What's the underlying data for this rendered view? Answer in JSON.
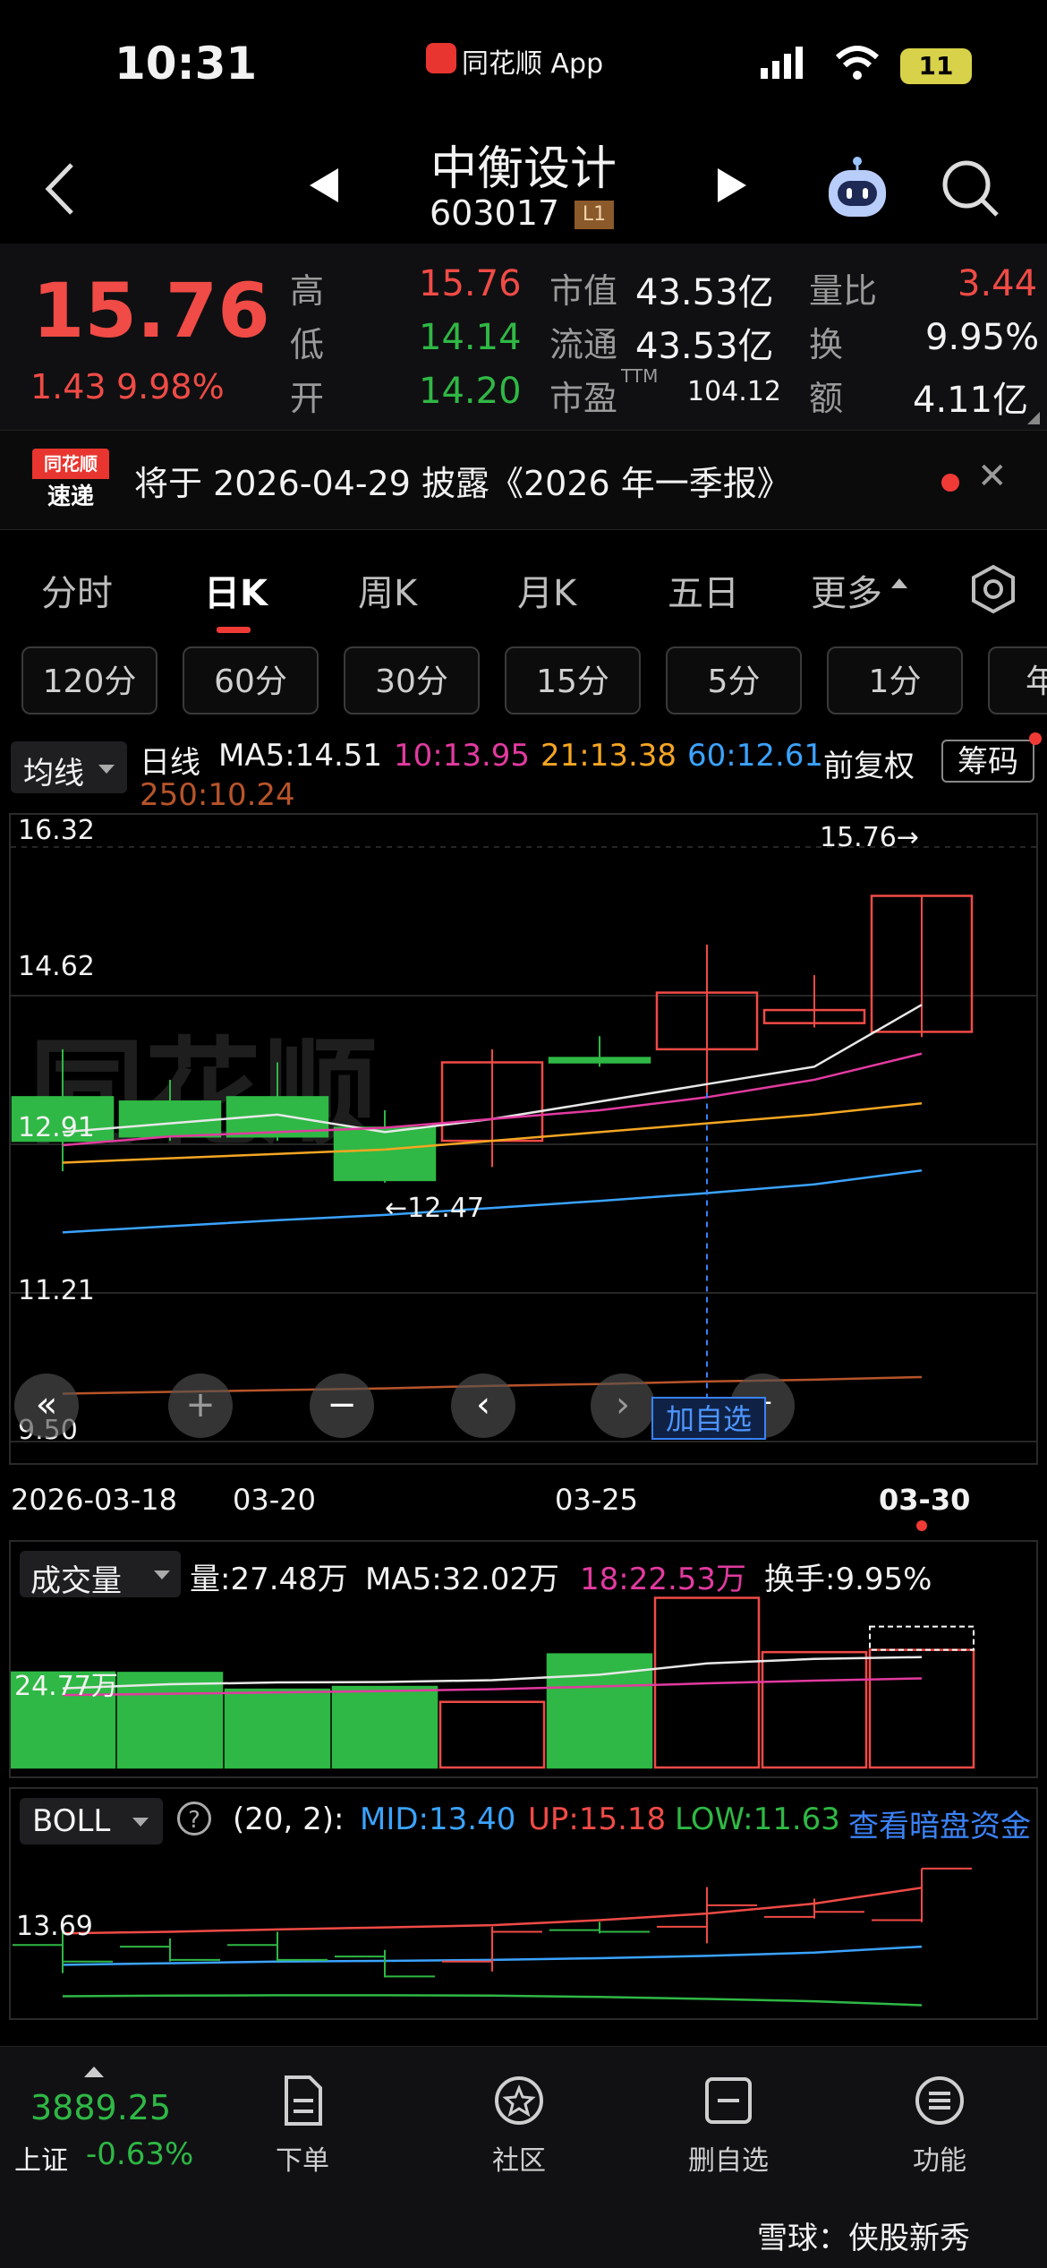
{
  "status_bar": {
    "time": "10:31",
    "app": "同花顺 App",
    "battery": "11"
  },
  "nav": {
    "name": "中衡设计",
    "code": "603017",
    "level_badge": "L1"
  },
  "quote": {
    "price": "15.76",
    "change": "1.43",
    "change_pct": "9.98%",
    "high_label": "高",
    "high": "15.76",
    "low_label": "低",
    "low": "14.14",
    "open_label": "开",
    "open": "14.20",
    "mcap_label": "市值",
    "mcap": "43.53亿",
    "float_label": "流通",
    "float": "43.53亿",
    "pe_label": "市盈",
    "pe_sup": "TTM",
    "pe": "104.12",
    "vr_label": "量比",
    "vr": "3.44",
    "turn_label": "换",
    "turn": "9.95%",
    "amt_label": "额",
    "amt": "4.11亿"
  },
  "notice": {
    "logo_top": "同花顺",
    "logo_bottom": "速递",
    "text": "将于 2026-04-29 披露《2026 年一季报》"
  },
  "tabs": [
    "分时",
    "日K",
    "周K",
    "月K",
    "五日",
    "更多"
  ],
  "active_tab": 1,
  "minute_buttons": [
    "120分",
    "60分",
    "30分",
    "15分",
    "5分",
    "1分",
    "年"
  ],
  "ma": {
    "selector": "均线",
    "kline_label": "日线",
    "ma5": "MA5:14.51",
    "ma10": "10:13.95",
    "ma21": "21:13.38",
    "ma60": "60:12.61",
    "ma250": "250:10.24",
    "fq": "前复权",
    "chip": "筹码"
  },
  "colors": {
    "up": "#f04b46",
    "down": "#2fb845",
    "ma5": "#e8e8e8",
    "ma10": "#e23aa0",
    "ma21": "#f5a623",
    "ma60": "#3ba3ff",
    "ma250": "#b8542a",
    "accent": "#3b82f6"
  },
  "kchart": {
    "y_labels": [
      "16.32",
      "14.62",
      "12.91",
      "11.21",
      "9.50"
    ],
    "high_marker": "15.76→",
    "low_marker": "←12.47",
    "add_watch": "加自选",
    "x_labels": [
      "2026-03-18",
      "03-20",
      "03-25",
      "03-30"
    ]
  },
  "chart_data": {
    "type": "candlestick",
    "dates": [
      "2026-03-18",
      "2026-03-19",
      "2026-03-20",
      "2026-03-23",
      "2026-03-24",
      "2026-03-25",
      "2026-03-26",
      "2026-03-27",
      "2026-03-30"
    ],
    "open": [
      13.45,
      13.4,
      13.45,
      13.1,
      12.95,
      13.9,
      14.0,
      14.3,
      14.2
    ],
    "close": [
      12.95,
      13.0,
      13.0,
      12.5,
      13.85,
      13.85,
      14.65,
      14.45,
      15.76
    ],
    "high": [
      14.0,
      13.65,
      13.85,
      13.3,
      14.0,
      14.15,
      15.2,
      14.85,
      15.76
    ],
    "low": [
      12.6,
      12.95,
      12.95,
      12.47,
      12.65,
      13.8,
      13.5,
      14.25,
      14.14
    ],
    "ylim": [
      9.5,
      16.32
    ],
    "ma": {
      "MA5": [
        13.05,
        13.15,
        13.25,
        13.05,
        13.2,
        13.4,
        13.6,
        13.8,
        14.51
      ],
      "MA10": [
        12.9,
        13.0,
        13.05,
        13.1,
        13.2,
        13.3,
        13.45,
        13.65,
        13.95
      ],
      "MA21": [
        12.7,
        12.75,
        12.8,
        12.85,
        12.95,
        13.05,
        13.15,
        13.25,
        13.38
      ],
      "MA60": [
        11.9,
        11.97,
        12.04,
        12.1,
        12.18,
        12.26,
        12.35,
        12.45,
        12.61
      ],
      "MA250": [
        10.05,
        10.07,
        10.09,
        10.11,
        10.14,
        10.16,
        10.19,
        10.21,
        10.24
      ]
    },
    "volume": {
      "selector": "成交量",
      "vol": "量:27.48万",
      "ma5": "MA5:32.02万",
      "ma18": "18:22.53万",
      "turnover": "换手:9.95%",
      "y_label": "24.77万",
      "values": [
        21.0,
        20.9,
        17.2,
        17.8,
        14.5,
        25.0,
        37.5,
        25.5,
        26.0
      ]
    },
    "boll": {
      "selector": "BOLL",
      "params": "(20, 2):",
      "mid": "MID:13.40",
      "up": "UP:15.18",
      "low": "LOW:11.63",
      "link": "查看暗盘资金",
      "y_label": "13.69"
    }
  },
  "bottom": {
    "index_value": "3889.25",
    "index_name": "上证",
    "index_change": "-0.63%",
    "items": [
      "下单",
      "社区",
      "删自选",
      "功能"
    ],
    "watermark": "雪球：侠股新秀"
  }
}
